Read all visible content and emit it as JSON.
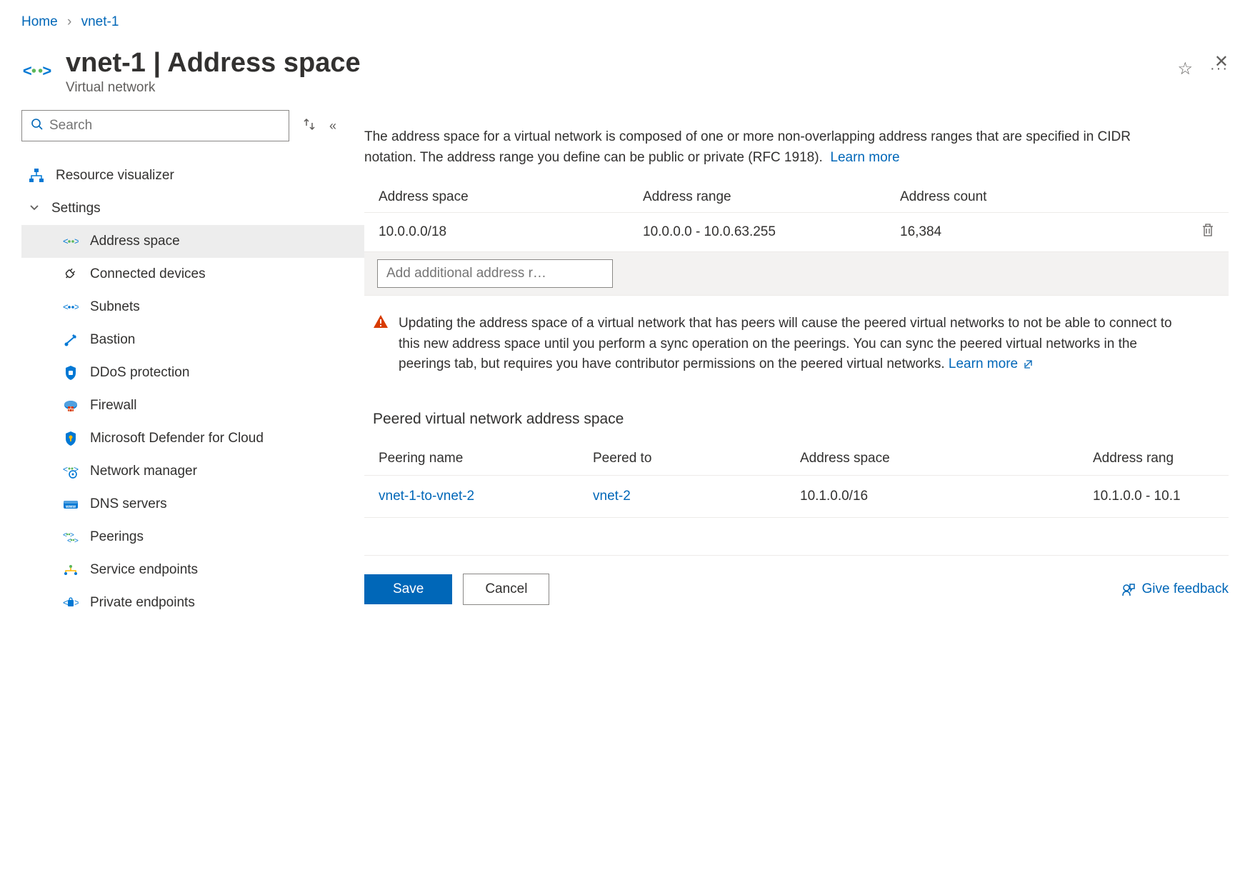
{
  "breadcrumb": {
    "home": "Home",
    "current": "vnet-1"
  },
  "header": {
    "title": "vnet-1 | Address space",
    "subtitle": "Virtual network"
  },
  "sidebar": {
    "search_placeholder": "Search",
    "resource_visualizer": "Resource visualizer",
    "settings_label": "Settings",
    "items": {
      "address_space": "Address space",
      "connected_devices": "Connected devices",
      "subnets": "Subnets",
      "bastion": "Bastion",
      "ddos": "DDoS protection",
      "firewall": "Firewall",
      "defender": "Microsoft Defender for Cloud",
      "network_manager": "Network manager",
      "dns": "DNS servers",
      "peerings": "Peerings",
      "service_endpoints": "Service endpoints",
      "private_endpoints": "Private endpoints"
    }
  },
  "main": {
    "description_text": "The address space for a virtual network is composed of one or more non-overlapping address ranges that are specified in CIDR notation. The address range you define can be public or private (RFC 1918).",
    "learn_more": "Learn more",
    "table": {
      "col_space": "Address space",
      "col_range": "Address range",
      "col_count": "Address count",
      "rows": [
        {
          "space": "10.0.0.0/18",
          "range": "10.0.0.0 - 10.0.63.255",
          "count": "16,384"
        }
      ],
      "add_placeholder": "Add additional address r…"
    },
    "warning_text": "Updating the address space of a virtual network that has peers will cause the peered virtual networks to not be able to connect to this new address space until you perform a sync operation on the peerings. You can sync the peered virtual networks in the peerings tab, but requires you have contributor permissions on the peered virtual networks.",
    "warning_learn_more": "Learn more",
    "peered_title": "Peered virtual network address space",
    "peered_table": {
      "col_name": "Peering name",
      "col_to": "Peered to",
      "col_space": "Address space",
      "col_range": "Address rang",
      "rows": [
        {
          "name": "vnet-1-to-vnet-2",
          "to": "vnet-2",
          "space": "10.1.0.0/16",
          "range": "10.1.0.0 - 10.1"
        }
      ]
    },
    "save_label": "Save",
    "cancel_label": "Cancel",
    "feedback_label": "Give feedback"
  }
}
